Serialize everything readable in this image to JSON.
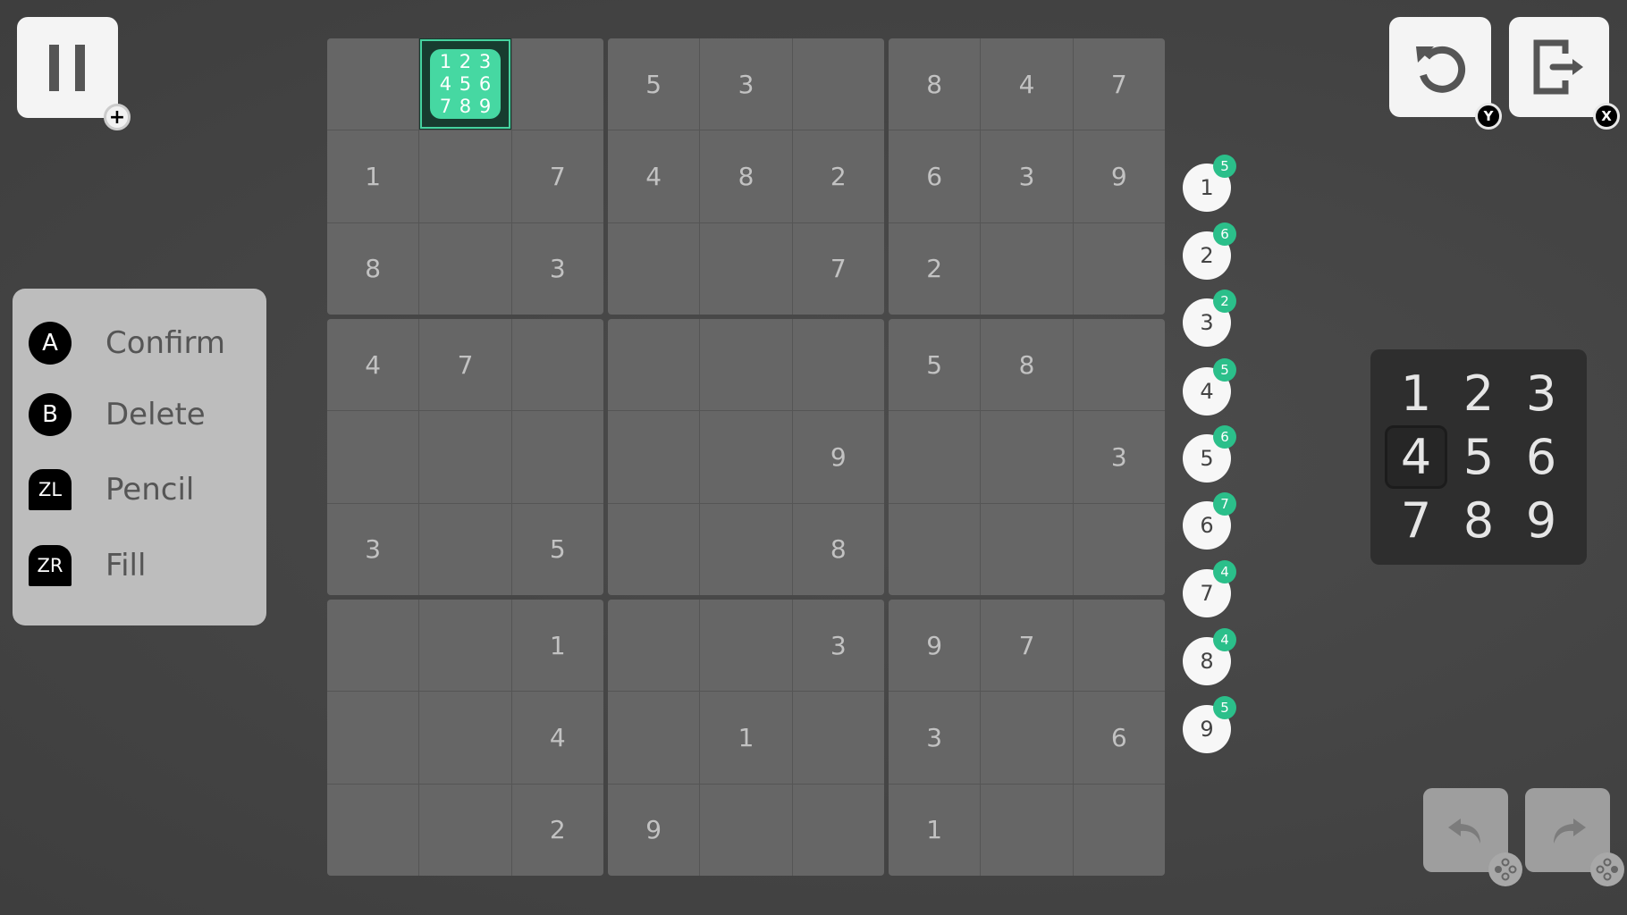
{
  "buttons": {
    "pause": {
      "icon": "pause-icon",
      "badge": "+"
    },
    "restart": {
      "icon": "restart-icon",
      "badge": "Y"
    },
    "exit": {
      "icon": "exit-icon",
      "badge": "X"
    },
    "undo": {
      "icon": "undo-icon"
    },
    "redo": {
      "icon": "redo-icon"
    }
  },
  "legend": [
    {
      "key": "A",
      "label": "Confirm"
    },
    {
      "key": "B",
      "label": "Delete"
    },
    {
      "key": "ZL",
      "label": "Pencil"
    },
    {
      "key": "ZR",
      "label": "Fill"
    }
  ],
  "grid": {
    "rows": [
      [
        "",
        "*",
        "",
        "5",
        "3",
        "",
        "8",
        "4",
        "7"
      ],
      [
        "1",
        "",
        "7",
        "4",
        "8",
        "2",
        "6",
        "3",
        "9"
      ],
      [
        "8",
        "",
        "3",
        "",
        "",
        "7",
        "2",
        "",
        ""
      ],
      [
        "4",
        "7",
        "",
        "",
        "",
        "",
        "5",
        "8",
        ""
      ],
      [
        "",
        "",
        "",
        "",
        "",
        "9",
        "",
        "",
        "3"
      ],
      [
        "3",
        "",
        "5",
        "",
        "",
        "8",
        "",
        "",
        ""
      ],
      [
        "",
        "",
        "1",
        "",
        "",
        "3",
        "9",
        "7",
        ""
      ],
      [
        "",
        "",
        "4",
        "",
        "1",
        "",
        "3",
        "",
        "6"
      ],
      [
        "",
        "",
        "2",
        "9",
        "",
        "",
        "1",
        "",
        ""
      ]
    ],
    "selected": {
      "row": 1,
      "col": 2
    },
    "pencil_notes": [
      "1",
      "2",
      "3",
      "4",
      "5",
      "6",
      "7",
      "8",
      "9"
    ]
  },
  "number_counts": [
    {
      "digit": "1",
      "count": "5"
    },
    {
      "digit": "2",
      "count": "6"
    },
    {
      "digit": "3",
      "count": "2"
    },
    {
      "digit": "4",
      "count": "5"
    },
    {
      "digit": "5",
      "count": "6"
    },
    {
      "digit": "6",
      "count": "7"
    },
    {
      "digit": "7",
      "count": "4"
    },
    {
      "digit": "8",
      "count": "4"
    },
    {
      "digit": "9",
      "count": "5"
    }
  ],
  "numpad": {
    "keys": [
      "1",
      "2",
      "3",
      "4",
      "5",
      "6",
      "7",
      "8",
      "9"
    ],
    "selected": "4"
  },
  "colors": {
    "accent": "#46d8a2",
    "badge": "#2bbf8a"
  }
}
